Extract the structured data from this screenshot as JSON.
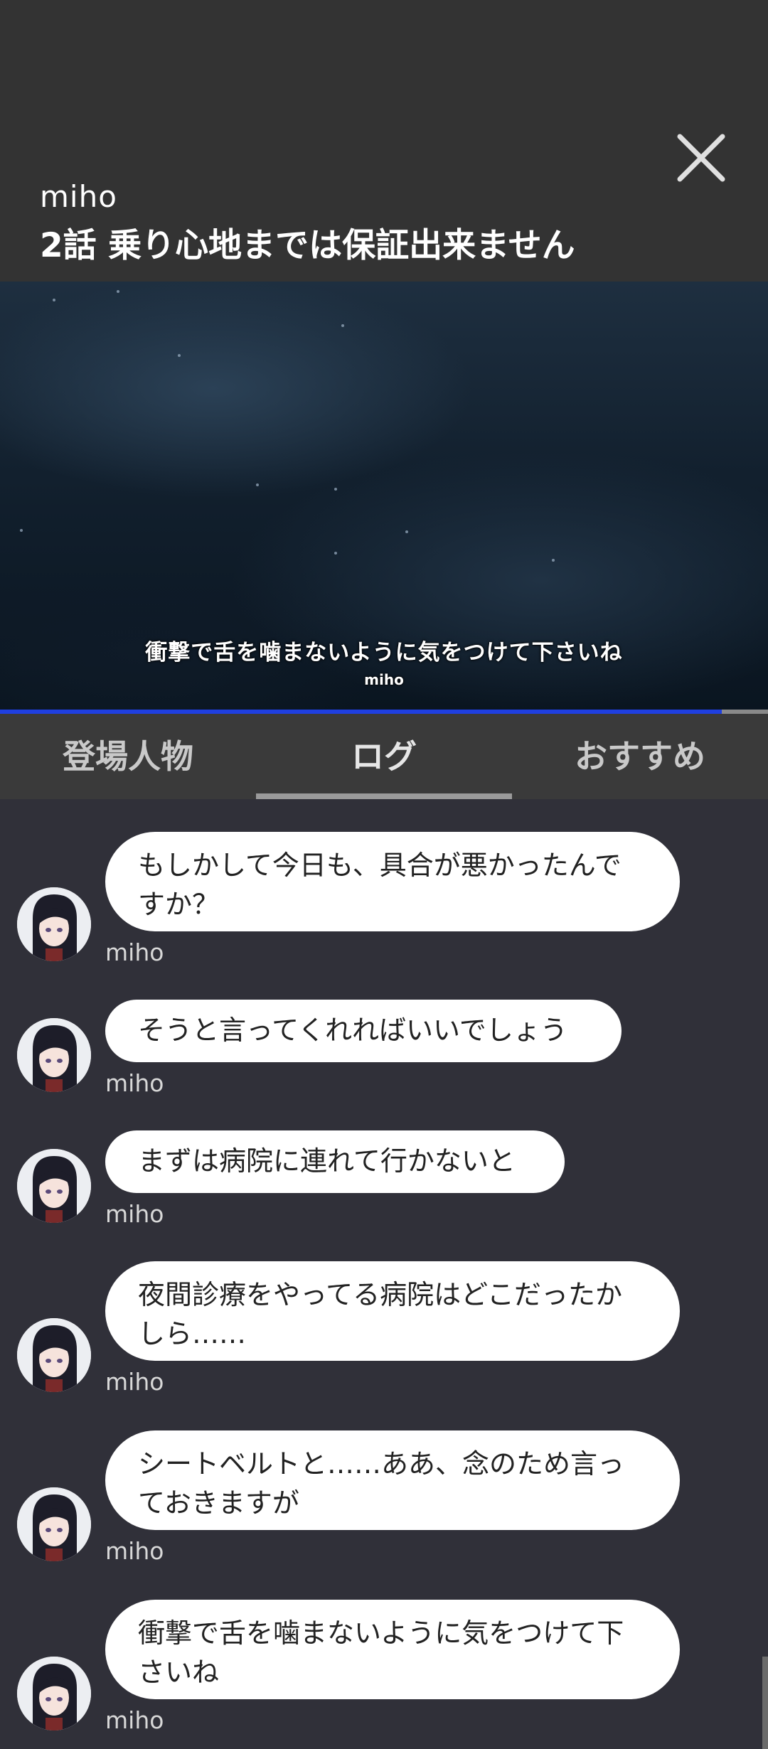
{
  "header": {
    "speaker": "miho",
    "episode_title": "2話 乗り心地までは保証出来ません",
    "close_icon": "close-icon"
  },
  "scene": {
    "subtitle": "衝撃で舌を噛まないように気をつけて下さいね",
    "subtitle_speaker": "miho",
    "progress_fraction": 0.94,
    "progress_color": "#1f3fe0"
  },
  "tabs": [
    {
      "label": "登場人物",
      "active": false
    },
    {
      "label": "ログ",
      "active": true
    },
    {
      "label": "おすすめ",
      "active": false
    }
  ],
  "log": [
    {
      "speaker": "miho",
      "lines": [
        "もしかして今日も、具合が悪かったんで",
        "すか？"
      ]
    },
    {
      "speaker": "miho",
      "lines": [
        "そうと言ってくれればいいでしょう"
      ]
    },
    {
      "speaker": "miho",
      "lines": [
        "まずは病院に連れて行かないと"
      ]
    },
    {
      "speaker": "miho",
      "lines": [
        "夜間診療をやってる病院はどこだったか",
        "しら……"
      ]
    },
    {
      "speaker": "miho",
      "lines": [
        "シートベルトと……ああ、念のため言っ",
        "ておきますが"
      ]
    },
    {
      "speaker": "miho",
      "lines": [
        "衝撃で舌を噛まないように気をつけて下",
        "さいね"
      ]
    }
  ]
}
